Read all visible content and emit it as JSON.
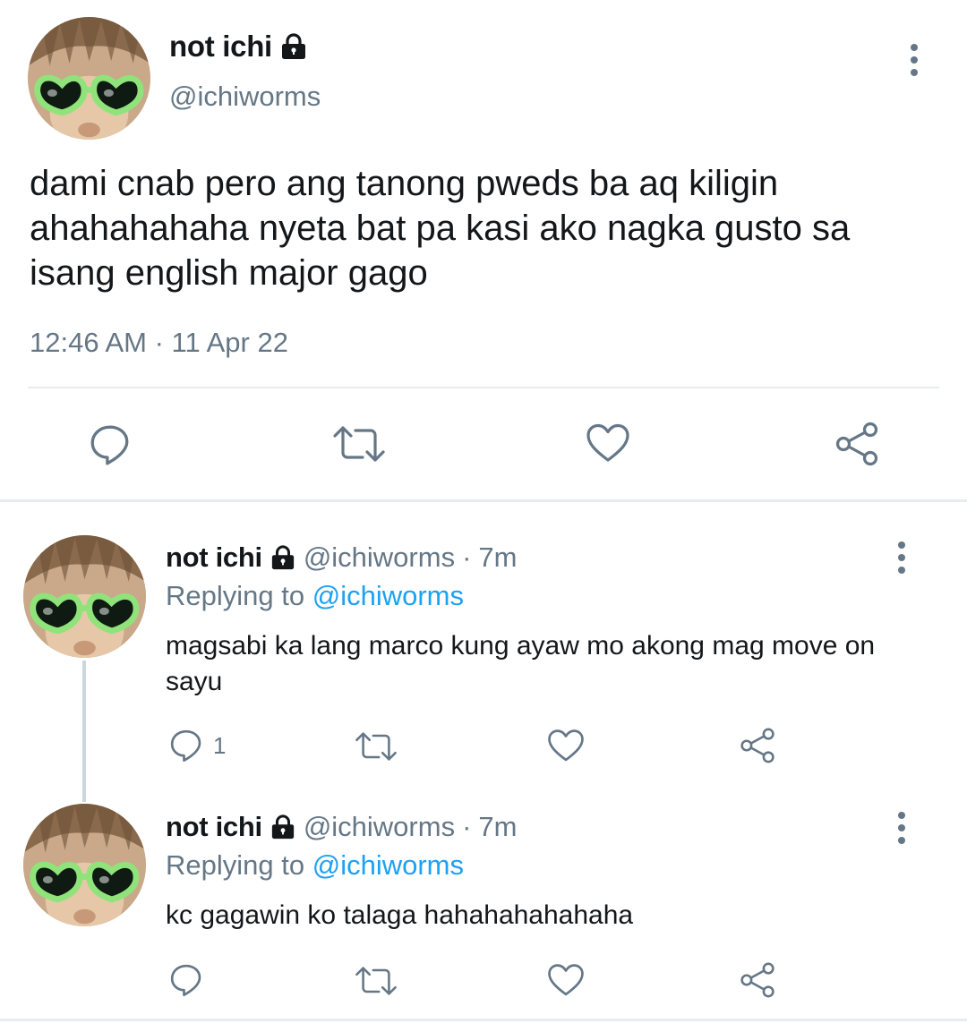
{
  "main_tweet": {
    "display_name": "not ichi",
    "handle": "@ichiworms",
    "text": "dami cnab pero ang tanong pweds ba aq kiligin ahahahahaha nyeta bat pa kasi ako nagka gusto sa isang english major gago",
    "timestamp": "12:46 AM · 11 Apr 22",
    "protected_icon": "lock-icon"
  },
  "replies": [
    {
      "display_name": "not ichi",
      "handle": "@ichiworms",
      "separator": "·",
      "time": "7m",
      "replying_prefix": "Replying to",
      "replying_to": "@ichiworms",
      "text": "magsabi ka lang marco kung ayaw mo akong mag move on sayu",
      "reply_count": "1"
    },
    {
      "display_name": "not ichi",
      "handle": "@ichiworms",
      "separator": "·",
      "time": "7m",
      "replying_prefix": "Replying to",
      "replying_to": "@ichiworms",
      "text": "kc gagawin ko talaga hahahahahahaha"
    }
  ],
  "colors": {
    "text": "#14171a",
    "secondary": "#657786",
    "link": "#1da1f2",
    "divider": "#e6ecf0"
  }
}
